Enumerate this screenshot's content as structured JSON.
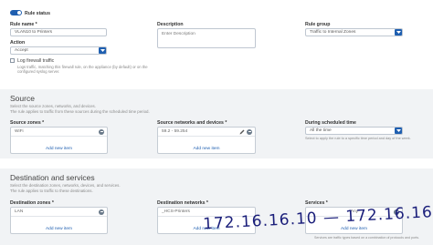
{
  "rule_status": {
    "label": "Rule status",
    "enabled": true
  },
  "rule_name": {
    "label": "Rule name *",
    "value": "VLAN10 to Printers"
  },
  "description": {
    "label": "Description",
    "placeholder": "Enter Description"
  },
  "rule_group": {
    "label": "Rule group",
    "value": "Traffic to Internal Zones"
  },
  "action": {
    "label": "Action",
    "value": "Accept"
  },
  "log_traffic": {
    "label": "Log firewall traffic",
    "checked": false,
    "help1": "Logs traffic, matching this firewall rule, on the appliance (by default) or on the",
    "help2": "configured syslog server."
  },
  "source": {
    "title": "Source",
    "desc1": "Select the source zones, networks, and devices.",
    "desc2": "The rule applies to traffic from these sources during the scheduled time period.",
    "zones_label": "Source zones *",
    "zone_item": "WiFi",
    "networks_label": "Source networks and devices *",
    "network_item": "59.2 - 59.254",
    "add_label": "Add new item",
    "schedule_label": "During scheduled time",
    "schedule_value": "All the time",
    "schedule_help": "Select to apply the rule to a specific time period and day of the week."
  },
  "destination": {
    "title": "Destination and services",
    "desc1": "Select the destination zones, networks, devices, and services.",
    "desc2": "The rule applies to traffic to these destinations.",
    "zones_label": "Destination zones *",
    "zone_item": "LAN",
    "networks_label": "Destination networks *",
    "network_item": "_HCS-Printers",
    "services_label": "Services *",
    "services_item": "Any",
    "add_label": "Add new item",
    "services_help": "Services are traffic types based on a combination of protocols and ports."
  },
  "annotation": {
    "text": "172.16.16.10 — 172.16.16.54"
  },
  "colors": {
    "accent": "#1f5fb0",
    "section_bg": "#f1f3f5",
    "annotation_ink": "#1a1e7a"
  }
}
